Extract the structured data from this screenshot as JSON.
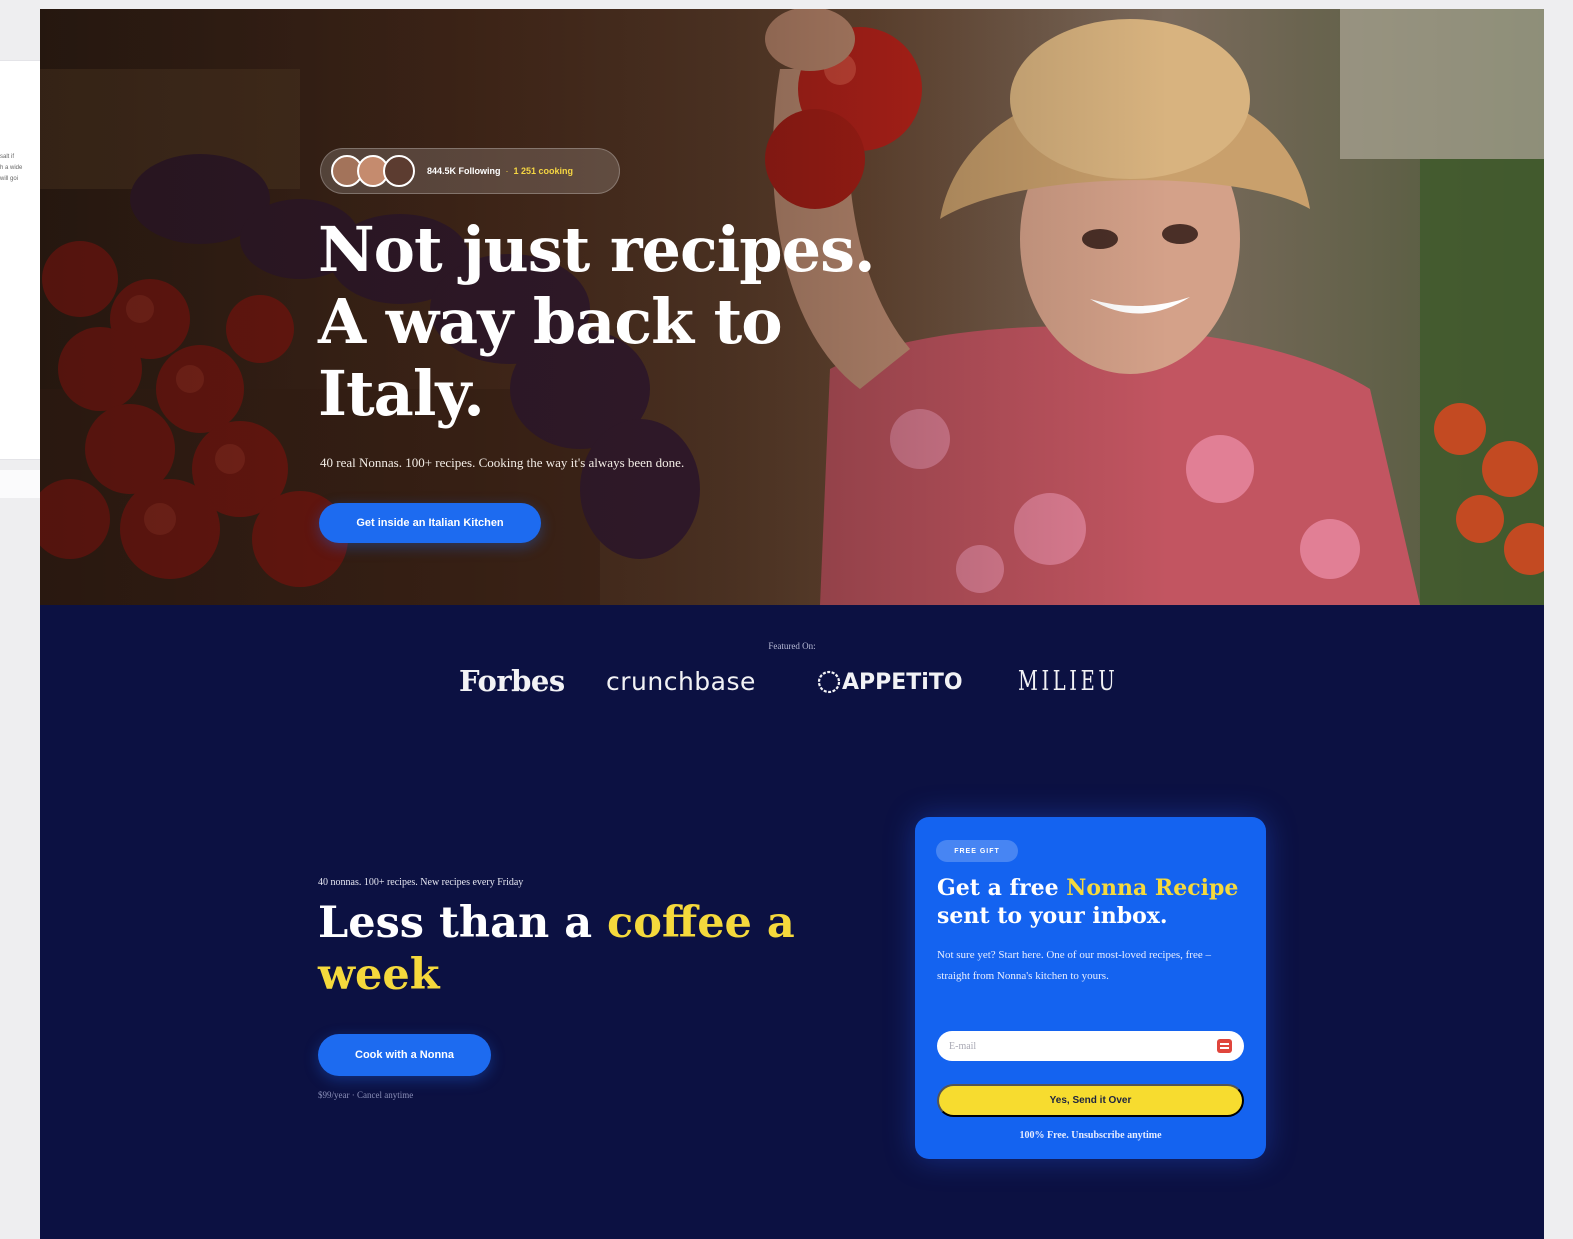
{
  "hero": {
    "social": {
      "following": "844.5K Following",
      "separator": "·",
      "cooking": "1 251 cooking"
    },
    "title_line1": "Not just recipes.",
    "title_line2": "A way back to",
    "title_line3": "Italy.",
    "subtitle": "40 real Nonnas. 100+ recipes. Cooking the way it's always been done.",
    "cta_label": "Get inside an Italian Kitchen"
  },
  "featured": {
    "label": "Featured On:",
    "logos": [
      "Forbes",
      "crunchbase",
      "APPETiTO",
      "MILIEU"
    ]
  },
  "pricing": {
    "kicker": "40 nonnas. 100+ recipes. New recipes every Friday",
    "title_part1": "Less than a ",
    "title_highlight": "coffee a week",
    "cta_label": "Cook with a Nonna",
    "note": "$99/year · Cancel anytime"
  },
  "gift": {
    "badge": "FREE GIFT",
    "title_part1": "Get a free ",
    "title_highlight": "Nonna Recipe",
    "title_part2": "sent to your inbox.",
    "description": "Not sure yet? Start here. One of our most-loved recipes, free – straight from Nonna's kitchen to yours.",
    "email_placeholder": "E-mail",
    "submit_label": "Yes, Send it Over",
    "footnote": "100% Free. Unsubscribe anytime"
  },
  "background_fragment": {
    "lines": [
      "salt if",
      "h a wide",
      "will goi"
    ]
  },
  "colors": {
    "navy": "#0c1142",
    "blue": "#1d6bf0",
    "yellow": "#f5d93c"
  }
}
